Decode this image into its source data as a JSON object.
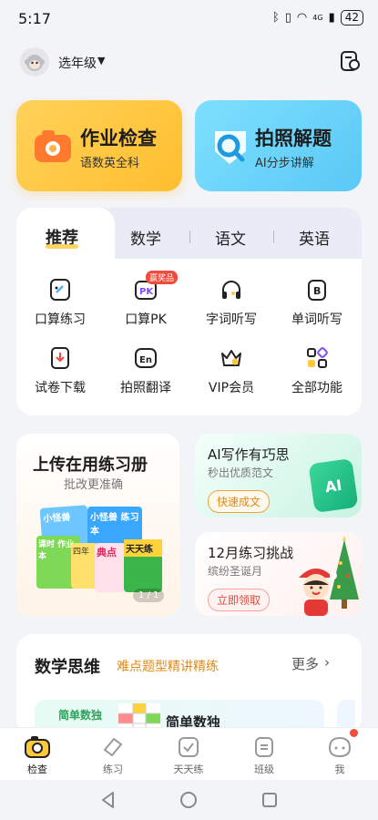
{
  "status": {
    "time": "5:17",
    "battery": "42",
    "signal": "4G"
  },
  "header": {
    "grade_label": "选年级"
  },
  "cards": {
    "homework": {
      "title": "作业检查",
      "subtitle": "语数英全科"
    },
    "photo": {
      "title": "拍照解题",
      "subtitle": "AI分步讲解"
    }
  },
  "tabs": [
    {
      "label": "推荐"
    },
    {
      "label": "数学"
    },
    {
      "label": "语文"
    },
    {
      "label": "英语"
    }
  ],
  "grid": [
    {
      "label": "口算练习",
      "icon": "pencil-note-icon"
    },
    {
      "label": "口算PK",
      "icon": "pk-icon",
      "badge": "赢奖品"
    },
    {
      "label": "字词听写",
      "icon": "headphones-icon"
    },
    {
      "label": "单词听写",
      "icon": "letter-b-icon"
    },
    {
      "label": "试卷下载",
      "icon": "download-paper-icon"
    },
    {
      "label": "拍照翻译",
      "icon": "translate-en-icon"
    },
    {
      "label": "VIP会员",
      "icon": "crown-icon"
    },
    {
      "label": "全部功能",
      "icon": "all-features-icon"
    }
  ],
  "upload": {
    "title": "上传在用练习册",
    "subtitle": "批改更准确",
    "pager": "1 / 1",
    "books": [
      "小怪兽",
      "小怪兽 练习本",
      "课时 作业本",
      "四年",
      "典点",
      "天天练"
    ]
  },
  "ai_writing": {
    "title": "AI写作有巧思",
    "subtitle": "秒出优质范文",
    "button": "快速成文",
    "logo": "AI"
  },
  "challenge": {
    "title": "12月练习挑战",
    "subtitle": "缤纷圣诞月",
    "button": "立即领取"
  },
  "math": {
    "title": "数学思维",
    "subtitle": "难点题型精讲精练",
    "more": "更多",
    "item_tag": "简单数独",
    "item_title": "简单数独"
  },
  "bottom_nav": [
    {
      "label": "检查",
      "active": true
    },
    {
      "label": "练习"
    },
    {
      "label": "天天练"
    },
    {
      "label": "班级"
    },
    {
      "label": "我"
    }
  ],
  "colors": {
    "accent_yellow": "#ffc93c",
    "accent_blue": "#5ac8f5",
    "orange_text": "#e08a14",
    "red": "#f04b3b"
  }
}
